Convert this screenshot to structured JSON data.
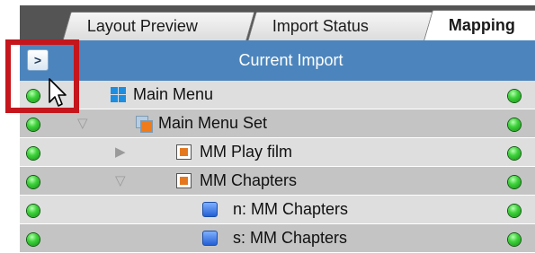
{
  "tabs": [
    {
      "label": "Layout Preview",
      "active": false
    },
    {
      "label": "Import Status",
      "active": false
    },
    {
      "label": "Mapping",
      "active": true
    }
  ],
  "header": {
    "expand_label": ">",
    "title": "Current Import"
  },
  "tree": [
    {
      "label": "Main Menu",
      "icon": "menu-grid-icon",
      "expander": "",
      "status": "green"
    },
    {
      "label": "Main Menu Set",
      "icon": "menu-set-icon",
      "expander": "expanded",
      "status": "green"
    },
    {
      "label": "MM Play film",
      "icon": "film-icon",
      "expander": "collapsed",
      "status": "green"
    },
    {
      "label": "MM Chapters",
      "icon": "film-icon",
      "expander": "expanded",
      "status": "green"
    },
    {
      "label": "n: MM Chapters",
      "icon": "blue-square-icon",
      "expander": "",
      "status": "green"
    },
    {
      "label": "s: MM Chapters",
      "icon": "blue-square-icon",
      "expander": "",
      "status": "green"
    }
  ],
  "glyphs": {
    "expanded": "▽",
    "collapsed": "▶"
  },
  "colors": {
    "header_bg": "#4c85bd",
    "tabbar_bg": "#545454",
    "status_green": "#3fd33c",
    "highlight_red": "#c4161c"
  }
}
